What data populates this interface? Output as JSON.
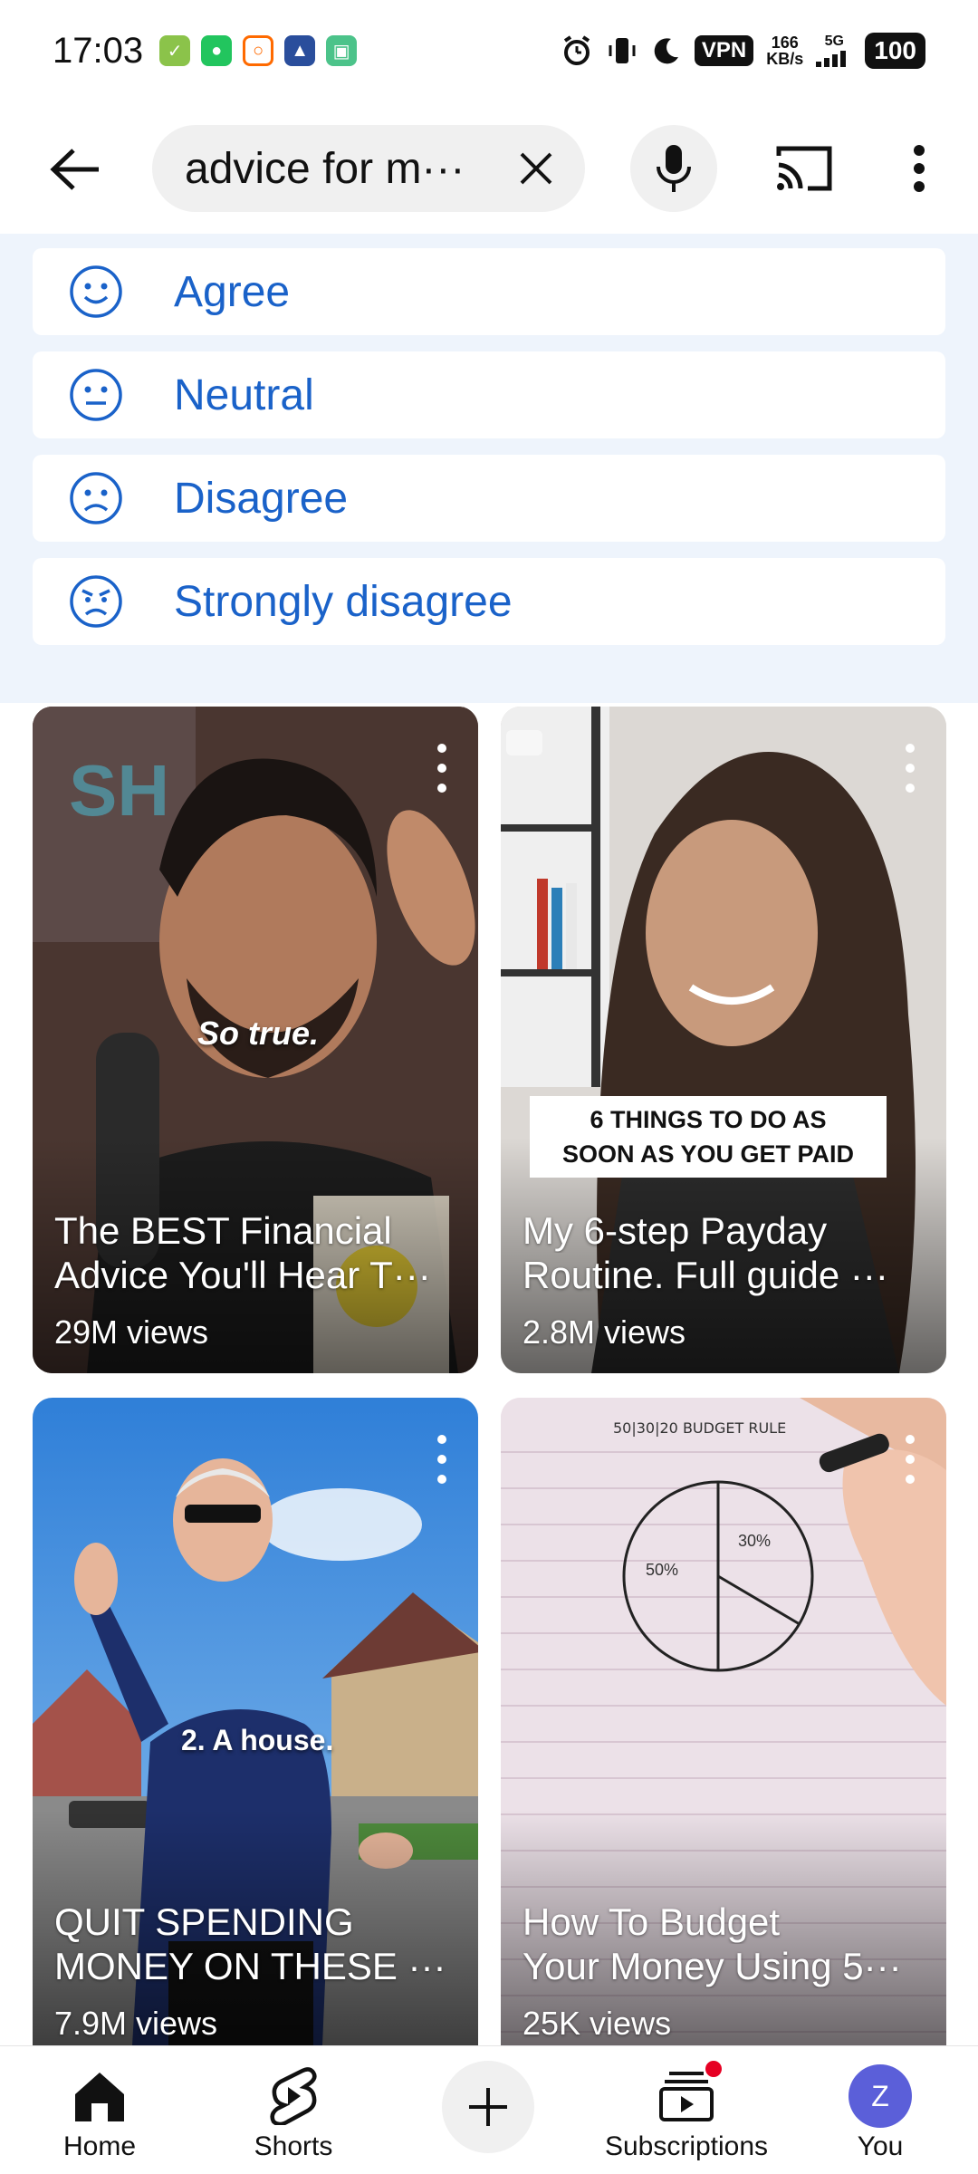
{
  "status_bar": {
    "time": "17:03",
    "vpn": "VPN",
    "speed_value": "166",
    "speed_unit": "KB/s",
    "network": "5G",
    "battery": "100"
  },
  "header": {
    "search_text": "advice for m···"
  },
  "survey": {
    "options": [
      {
        "label": "Agree",
        "icon": "smile-face-icon"
      },
      {
        "label": "Neutral",
        "icon": "neutral-face-icon"
      },
      {
        "label": "Disagree",
        "icon": "frown-face-icon"
      },
      {
        "label": "Strongly disagree",
        "icon": "angry-face-icon"
      }
    ],
    "accent_color": "#1a62c9"
  },
  "videos": [
    {
      "title_line1": "The BEST Financial",
      "title_line2": "Advice You'll Hear T···",
      "views": "29M views",
      "overlay": "So true."
    },
    {
      "title_line1": "My 6-step Payday",
      "title_line2": "Routine. Full guide ···",
      "views": "2.8M views",
      "overlay_line1": "6 THINGS TO DO AS",
      "overlay_line2": "SOON AS YOU GET PAID"
    },
    {
      "title_line1": "QUIT SPENDING",
      "title_line2": "MONEY ON THESE ···",
      "views": "7.9M views",
      "overlay": "2. A house."
    },
    {
      "title_line1": "How To Budget",
      "title_line2": "Your Money Using 5···",
      "views": "25K views",
      "overlay": "50|30|20 BUDGET RULE",
      "chart_50": "50%",
      "chart_30": "30%"
    }
  ],
  "bottom_nav": {
    "home": "Home",
    "shorts": "Shorts",
    "subscriptions": "Subscriptions",
    "you": "You",
    "avatar_letter": "Z"
  }
}
